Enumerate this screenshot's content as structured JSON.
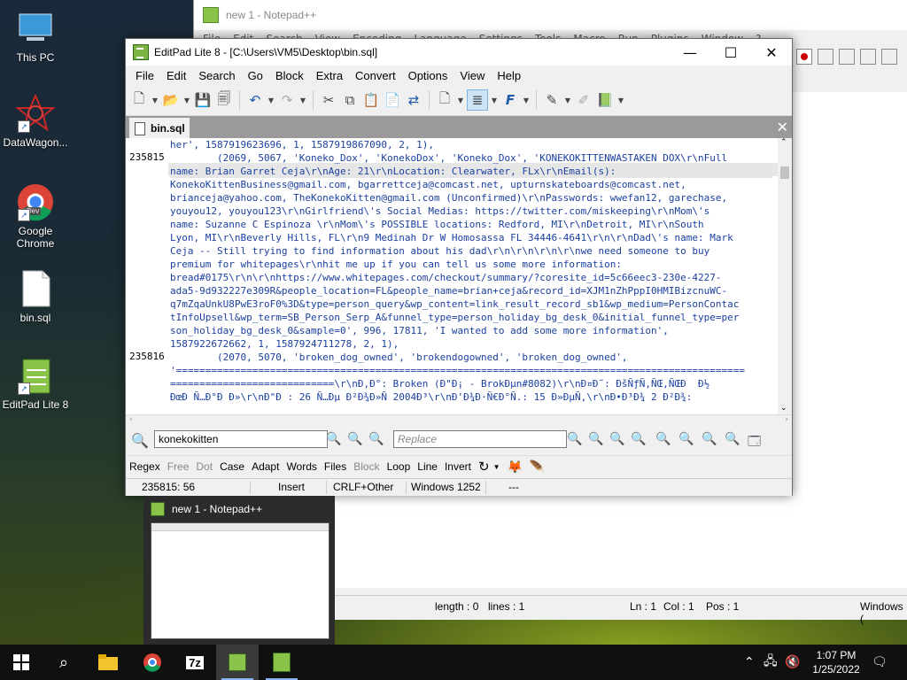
{
  "desktop": {
    "icons": [
      {
        "label": "This PC"
      },
      {
        "label": "DataWagon..."
      },
      {
        "label": "Google Chrome"
      },
      {
        "label": "bin.sql"
      },
      {
        "label": "EditPad Lite 8"
      }
    ],
    "chrome_badge": "Dev"
  },
  "notepadpp": {
    "title": "new 1 - Notepad++",
    "menu": [
      "File",
      "Edit",
      "Search",
      "View",
      "Encoding",
      "Language",
      "Settings",
      "Tools",
      "Macro",
      "Run",
      "Plugins",
      "Window",
      "?"
    ],
    "status": {
      "length": "length : 0",
      "lines": "lines : 1",
      "ln": "Ln : 1",
      "col": "Col : 1",
      "pos": "Pos : 1",
      "eol": "Windows ("
    }
  },
  "editpad": {
    "title": "EditPad Lite 8 - [C:\\Users\\VM5\\Desktop\\bin.sql]",
    "menu": [
      "File",
      "Edit",
      "Search",
      "Go",
      "Block",
      "Extra",
      "Convert",
      "Options",
      "View",
      "Help"
    ],
    "tab": "bin.sql",
    "line_numbers": [
      {
        "n": "235815",
        "row": 1
      },
      {
        "n": "235816",
        "row": 16
      }
    ],
    "lines": [
      "her', 1587919623696, 1, 1587919867090, 2, 1),",
      "        (2069, 5067, 'Koneko_Dox', 'KonekoDox', 'Koneko_Dox', 'KONEKOKITTENWASTAKEN DOX\\r\\nFull",
      "name: Brian Garret Ceja\\r\\nAge: 21\\r\\nLocation: Clearwater, FLx\\r\\nEmail(s):",
      "KonekoKittenBusiness@gmail.com, bgarrettceja@comcast.net, upturnskateboards@comcast.net,",
      "brianceja@yahoo.com, TheKonekoKitten@gmail.com (Unconfirmed)\\r\\nPasswords: wwefan12, garechase,",
      "youyou12, youyou123\\r\\nGirlfriend\\'s Social Medias: https://twitter.com/miskeeping\\r\\nMom\\'s",
      "name: Suzanne C Espinoza \\r\\nMom\\'s POSSIBLE locations: Redford, MI\\r\\nDetroit, MI\\r\\nSouth",
      "Lyon, MI\\r\\nBeverly Hills, FL\\r\\n9 Medinah Dr W Homosassa FL 34446-4641\\r\\n\\r\\nDad\\'s name: Mark",
      "Ceja -- Still trying to find information about his dad\\r\\n\\r\\n\\r\\n\\r\\nwe need someone to buy",
      "premium for whitepages\\r\\nhit me up if you can tell us some more information:",
      "bread#0175\\r\\n\\r\\nhttps://www.whitepages.com/checkout/summary/?coresite_id=5c66eec3-230e-4227-",
      "ada5-9d932227e309R&people_location=FL&people_name=brian+ceja&record_id=XJM1nZhPppI0HMIBizcnuWC-",
      "q7mZqaUnkU8PwE3roF0%3D&type=person_query&wp_content=link_result_record_sb1&wp_medium=PersonContac",
      "tInfoUpsell&wp_term=SB_Person_Serp_A&funnel_type=person_holiday_bg_desk_0&initial_funnel_type=per",
      "son_holiday_bg_desk_0&sample=0', 996, 17811, 'I wanted to add some more information',",
      "1587922672662, 1, 1587924711278, 2, 1),",
      "        (2070, 5070, 'broken_dog_owned', 'brokendogowned', 'broken_dog_owned',",
      "'=================================================================================================",
      "============================\\r\\nÐ,Ð°: Broken (Ð\"Ð¡ - BrokÐµn#8082)\\r\\nÐ¤Ð˜: ÐšÑƒÑ‚ÑŒ,ÑŒÐ  Ð½",
      "ÐœÐ Ñ…Ð°Ð Ð»\\r\\nÐ\"Ð : 26 Ñ…Ðµ Ð²Ð¾Ð»Ñ 2004Ð³\\r\\nÐ'Ð¾Ð·Ñ€Ð°Ñ.: 15 Ð»ÐµÑ‚\\r\\nÐ•Ð³Ð¾ 2 Ð²Ð¾:"
    ],
    "search_text": "konekokitten",
    "replace_placeholder": "Replace",
    "options": [
      {
        "label": "Regex",
        "enabled": true
      },
      {
        "label": "Free",
        "enabled": false
      },
      {
        "label": "Dot",
        "enabled": false
      },
      {
        "label": "Case",
        "enabled": true
      },
      {
        "label": "Adapt",
        "enabled": true
      },
      {
        "label": "Words",
        "enabled": true
      },
      {
        "label": "Files",
        "enabled": true
      },
      {
        "label": "Block",
        "enabled": false
      },
      {
        "label": "Loop",
        "enabled": true
      },
      {
        "label": "Line",
        "enabled": true
      },
      {
        "label": "Invert",
        "enabled": true
      }
    ],
    "status": {
      "position": "235815: 56",
      "mode": "Insert",
      "line_break": "CRLF+Other",
      "encoding": "Windows 1252",
      "extra": "---"
    }
  },
  "preview": {
    "title": "new 1 - Notepad++"
  },
  "taskbar": {
    "time": "1:07 PM",
    "date": "1/25/2022",
    "sevenzip": "7z"
  }
}
